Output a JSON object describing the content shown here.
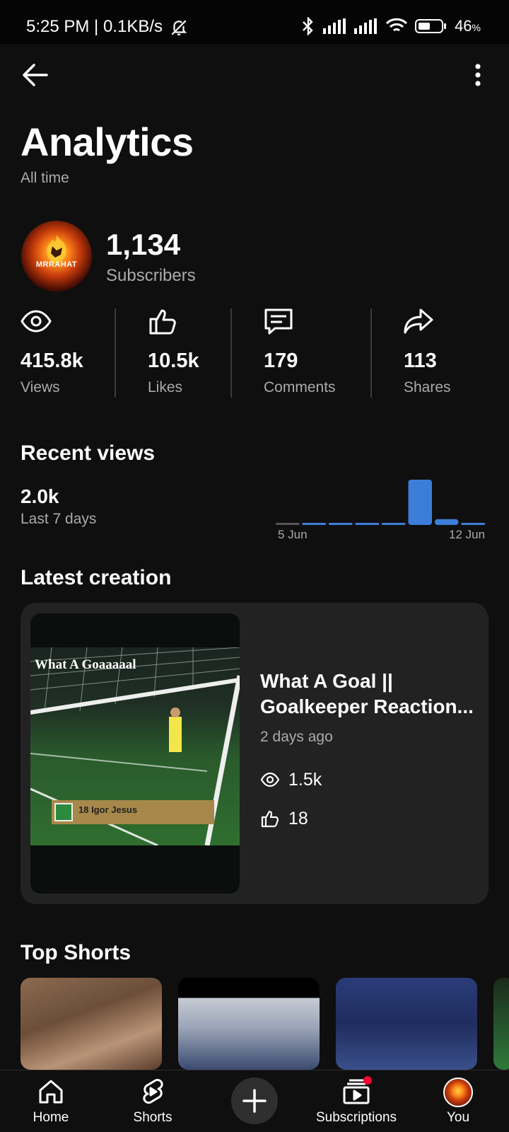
{
  "status_bar": {
    "time": "5:25 PM | 0.1KB/s",
    "battery": "46",
    "battery_unit": "%"
  },
  "header": {
    "title": "Analytics",
    "subtitle": "All time"
  },
  "channel": {
    "avatar_text": "MRRAHAT",
    "subscribers": "1,134",
    "subscribers_label": "Subscribers"
  },
  "stats": [
    {
      "icon": "eye-icon",
      "value": "415.8k",
      "label": "Views"
    },
    {
      "icon": "thumbs-up-icon",
      "value": "10.5k",
      "label": "Likes"
    },
    {
      "icon": "comment-icon",
      "value": "179",
      "label": "Comments"
    },
    {
      "icon": "share-icon",
      "value": "113",
      "label": "Shares"
    }
  ],
  "recent_views": {
    "title": "Recent views",
    "value": "2.0k",
    "period": "Last 7 days"
  },
  "chart_data": {
    "type": "bar",
    "categories": [
      "5 Jun",
      "6 Jun",
      "7 Jun",
      "8 Jun",
      "9 Jun",
      "10 Jun",
      "11 Jun",
      "12 Jun"
    ],
    "values": [
      0,
      10,
      10,
      10,
      10,
      1700,
      220,
      60
    ],
    "colors": [
      "#555555",
      "#3b7dd8",
      "#3b7dd8",
      "#3b7dd8",
      "#3b7dd8",
      "#3b7dd8",
      "#3b7dd8",
      "#3b7dd8"
    ],
    "tick_labels": [
      "5 Jun",
      "12 Jun"
    ],
    "accent": "#3b7dd8"
  },
  "latest": {
    "title": "Latest creation",
    "video_title_line1": "What A Goal   ||",
    "video_title_line2": "Goalkeeper Reaction...",
    "posted": "2 days ago",
    "views": "1.5k",
    "likes": "18",
    "thumb_caption": "What A Goaaaaal",
    "thumb_banner": "18 Igor Jesus"
  },
  "top_shorts": {
    "title": "Top Shorts"
  },
  "nav": {
    "home": "Home",
    "shorts": "Shorts",
    "subscriptions": "Subscriptions",
    "you": "You",
    "badge_color": "#ff0033"
  }
}
